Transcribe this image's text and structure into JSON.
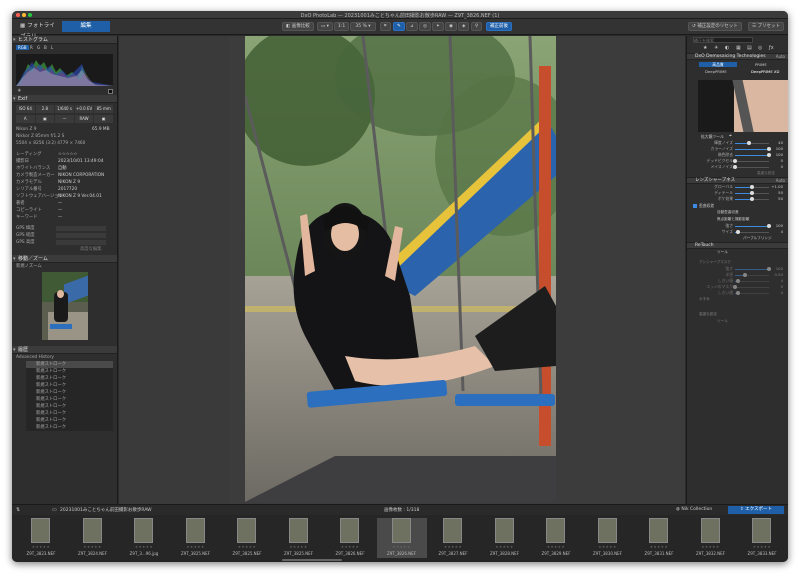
{
  "window": {
    "title": "DxO PhotoLab — 20231001みことちゃん前田撮影お散歩RAW — Z9T_3826.NEF (1)"
  },
  "toolbar": {
    "tab_library": "フォトライブラリ",
    "tab_customize": "編集",
    "compare_label": "画像比較",
    "zoom_fit": "1:1",
    "zoom_level": "35 %",
    "before_after_label": "補正前後",
    "reset_label": "補正設定のリセット",
    "presets_label": "プリセット"
  },
  "left": {
    "histogram_title": "ヒストグラム",
    "histogram_channels": [
      "RGB",
      "R",
      "G",
      "B",
      "L"
    ],
    "exif_title": "Exif",
    "exif_cells": [
      "ISO 64",
      "2.8",
      "1/640 s",
      "+0.0 EV",
      "85 mm"
    ],
    "exif_cells2": [
      "A",
      "▣",
      "—",
      "RAW",
      "▣"
    ],
    "camera": "Nikon Z 9",
    "camera_size": "65.9 MB",
    "lens": "Nikkor Z 85mm f/1.2 S",
    "dims": "5504 × 8256 (3:2) 4779 × 7460",
    "meta_rows": [
      {
        "k": "レーティング",
        "v": "☆☆☆☆☆"
      },
      {
        "k": "撮影日",
        "v": "2023/10/01 13:49:04"
      },
      {
        "k": "ホワイトバランス",
        "v": "自動"
      },
      {
        "k": "カメラ製造メーカー",
        "v": "NIKON CORPORATION"
      },
      {
        "k": "カメラモデル",
        "v": "NIKON Z 9"
      },
      {
        "k": "シリアル番号",
        "v": "2017720"
      },
      {
        "k": "ソフトウェアバージョン",
        "v": "NIKON Z 9 Ver.04.01"
      },
      {
        "k": "著者",
        "v": "—"
      },
      {
        "k": "コピーライト",
        "v": "—"
      },
      {
        "k": "キーワード",
        "v": "—"
      }
    ],
    "gps_rows": [
      "GPS 緯度",
      "GPS 経度",
      "GPS 高度"
    ],
    "gps_edit": "高度な編集",
    "nav_title": "移動／ズーム",
    "nav_sub": "新規ノズーム",
    "history_title": "履歴",
    "history_sub": "Advanced History",
    "history_items": [
      "新規ストローク",
      "新規ストローク",
      "新規ストローク",
      "新規ストローク",
      "新規ストローク",
      "新規ストローク",
      "新規ストローク",
      "新規ストローク",
      "新規ストローク",
      "新規ストローク"
    ]
  },
  "right": {
    "search_placeholder": "補正を検索",
    "demosaic_title": "DxO Demosaicing Technologies",
    "demosaic_badge": "Auto",
    "quality_label": "高品質",
    "prime_label": "PRIME",
    "deepprime_label": "DeepPRIME",
    "deepprime_xd_label": "DeepPRIME XD",
    "loupe_label": "拡大鏡ツール",
    "noise_sliders": [
      {
        "label": "輝度ノイズ",
        "value": "40",
        "frac": 0.4
      },
      {
        "label": "カラーノイズ",
        "value": "100",
        "frac": 1.0
      },
      {
        "label": "偽色除去",
        "value": "100",
        "frac": 1.0
      },
      {
        "label": "デッドピクセル",
        "value": "0",
        "frac": 0.0
      },
      {
        "label": "メイスノイズ",
        "value": "0",
        "frac": 0.0
      }
    ],
    "advanced_label": "高度な設定",
    "lens_title": "レンズシャープネス",
    "lens_badge": "Auto",
    "lens_sliders": [
      {
        "label": "グローバル",
        "value": "+1.00",
        "frac": 0.5
      },
      {
        "label": "ディテール",
        "value": "50",
        "frac": 0.5
      },
      {
        "label": "ボケ効果",
        "value": "50",
        "frac": 0.5
      }
    ],
    "distortion_label": "歪曲収差",
    "distortion_sub1": "自動歪曲収差",
    "distortion_sub2": "焦点距離と撮影距離",
    "dist_sliders": [
      {
        "label": "強さ",
        "value": "100",
        "frac": 1.0
      },
      {
        "label": "サイズ",
        "value": "4",
        "frac": 0.1
      }
    ],
    "fringe_label": "パープルフリンジ",
    "retouch_title": "ReTouch",
    "retouch_tool": "ツール",
    "anti_title": "アンシャープマスク",
    "anti_sliders": [
      {
        "label": "強さ",
        "value": "100",
        "frac": 1.0
      },
      {
        "label": "半径",
        "value": "0.50",
        "frac": 0.3
      },
      {
        "label": "しきい値",
        "value": "4",
        "frac": 0.1
      },
      {
        "label": "エッジのマスク",
        "value": "0",
        "frac": 0.0
      },
      {
        "label": "しきい値",
        "value": "4",
        "frac": 0.1
      }
    ],
    "haze_label": "かすみ",
    "extra_label": "高度な設定",
    "tool_label": "ツール"
  },
  "filmstrip": {
    "folder": "20231001みことちゃん前田撮影お散歩RAW",
    "count": "画像枚数 : 1/318",
    "collection_label": "Nik Collection",
    "export_label": "エクスポート",
    "thumbs": [
      "Z9T_3823.NEF",
      "Z9T_3824.NEF",
      "Z9T_3...96.jpg",
      "Z9T_3825.NEF",
      "Z9T_3825.NEF",
      "Z9T_3825.NEF",
      "Z9T_3826.NEF",
      "Z9T_3826.NEF",
      "Z9T_3827.NEF",
      "Z9T_3828.NEF",
      "Z9T_3829.NEF",
      "Z9T_3830.NEF",
      "Z9T_3831.NEF",
      "Z9T_3832.NEF",
      "Z9T_3833.NEF"
    ],
    "selected_index": 7
  }
}
